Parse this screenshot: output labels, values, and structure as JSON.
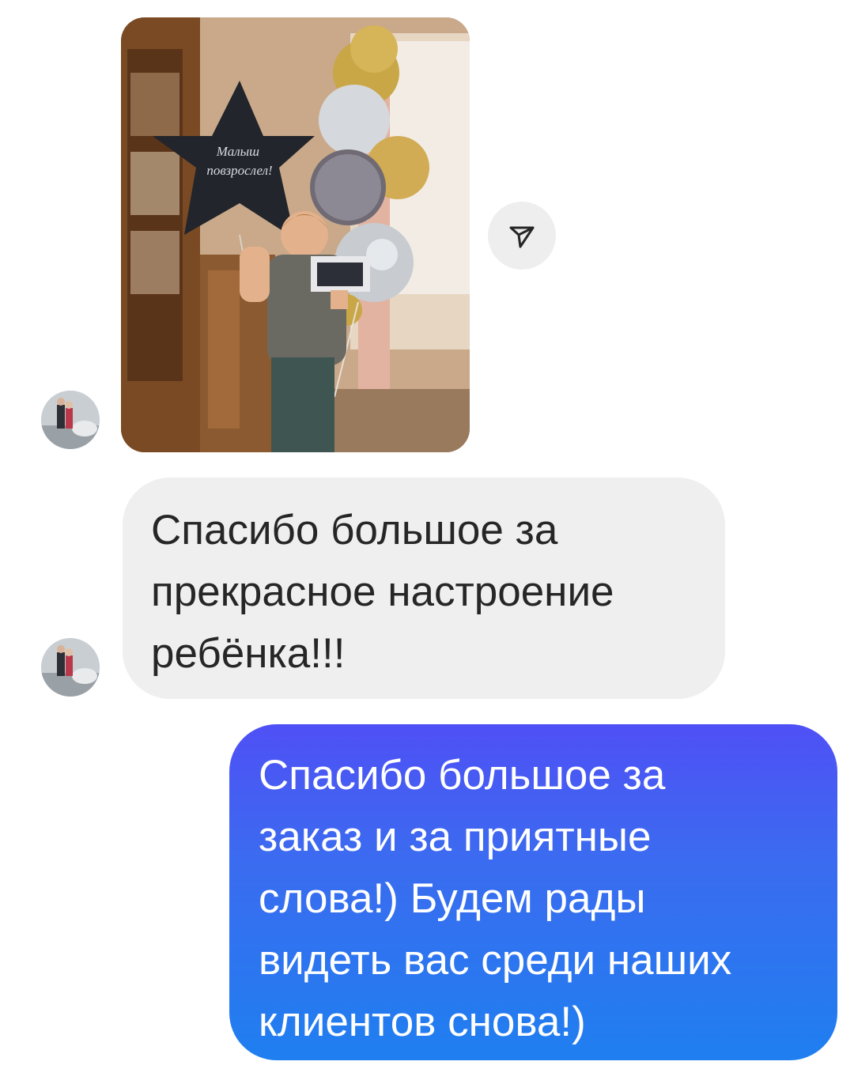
{
  "conversation": {
    "photo_message": {
      "balloon_text": "Малыш повзрослел!"
    },
    "incoming_message": {
      "text": "Спасибо большое за\nпрекрасное настроение\nребёнка!!!"
    },
    "outgoing_message": {
      "text": "Спасибо большое за\nзаказ и за приятные\nслова!) Будем рады\nвидеть вас среди наших\nклиентов снова!)"
    }
  },
  "icons": {
    "share": "paper-plane-icon",
    "avatar": "user-avatar"
  },
  "colors": {
    "incoming_bubble": "#efefef",
    "outgoing_bubble_top": "#4f50f5",
    "outgoing_bubble_bottom": "#1f7ff0",
    "text_dark": "#262626",
    "text_light": "#ffffff"
  }
}
